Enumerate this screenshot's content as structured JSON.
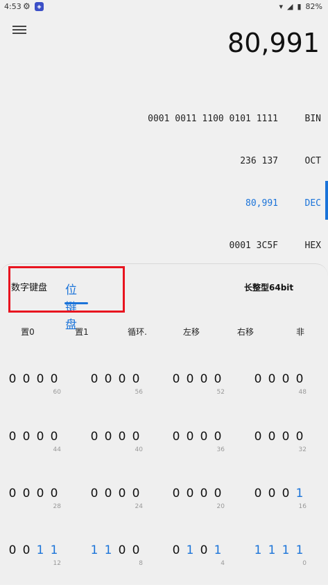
{
  "status": {
    "time": "4:53",
    "battery": "82%"
  },
  "display": {
    "main_value": "80,991"
  },
  "radix": [
    {
      "value": "0001 0011 1100 0101 1111",
      "label": "BIN",
      "active": false
    },
    {
      "value": "236 137",
      "label": "OCT",
      "active": false
    },
    {
      "value": "80,991",
      "label": "DEC",
      "active": true
    },
    {
      "value": "0001 3C5F",
      "label": "HEX",
      "active": false
    }
  ],
  "tabs": {
    "numeric": "数字键盘",
    "bit": "位键盘"
  },
  "word_size": "长整型64bit",
  "ops": [
    "置0",
    "置1",
    "循环.",
    "左移",
    "右移",
    "非"
  ],
  "bit_rows": [
    {
      "bits": "0000000000000000",
      "labels": [
        "60",
        "56",
        "52",
        "48"
      ]
    },
    {
      "bits": "0000000000000000",
      "labels": [
        "44",
        "40",
        "36",
        "32"
      ]
    },
    {
      "bits": "0000000000000001",
      "labels": [
        "28",
        "24",
        "20",
        "16"
      ]
    },
    {
      "bits": "0011110001011111",
      "labels": [
        "12",
        "8",
        "4",
        "0"
      ]
    }
  ],
  "colors": {
    "accent": "#1a73d9",
    "highlight": "#e8141f"
  }
}
